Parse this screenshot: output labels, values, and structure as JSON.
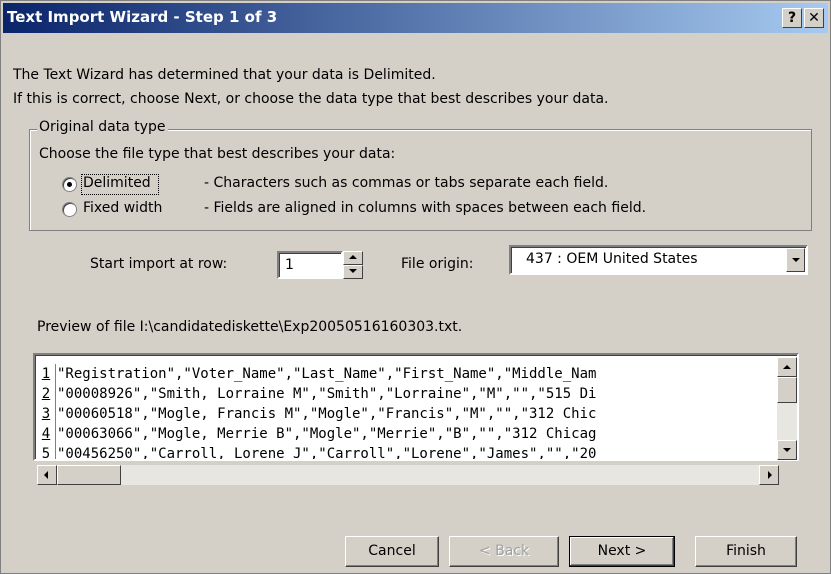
{
  "window": {
    "title": "Text Import Wizard - Step 1 of 3",
    "help_btn": "?",
    "close_btn": "✕"
  },
  "intro": {
    "line1": "The Text Wizard has determined that your data is Delimited.",
    "line2": "If this is correct, choose Next, or choose the data type that best describes your data."
  },
  "original_type": {
    "group_label": "Original data type",
    "prompt": "Choose the file type that best describes your data:",
    "options": [
      {
        "label": "Delimited",
        "desc": "- Characters such as commas or tabs separate each field.",
        "selected": true
      },
      {
        "label": "Fixed width",
        "desc": "- Fields are aligned in columns with spaces between each field.",
        "selected": false
      }
    ]
  },
  "start_row": {
    "label": "Start import at row:",
    "value": "1"
  },
  "file_origin": {
    "label": "File origin:",
    "value": "437 : OEM United States"
  },
  "preview": {
    "label": "Preview of file I:\\candidatediskette\\Exp20050516160303.txt.",
    "rows": [
      {
        "num": "1",
        "text": "\"Registration\",\"Voter_Name\",\"Last_Name\",\"First_Name\",\"Middle_Nam"
      },
      {
        "num": "2",
        "text": "\"00008926\",\"Smith, Lorraine M\",\"Smith\",\"Lorraine\",\"M\",\"\",\"515 Di"
      },
      {
        "num": "3",
        "text": "\"00060518\",\"Mogle, Francis M\",\"Mogle\",\"Francis\",\"M\",\"\",\"312 Chic"
      },
      {
        "num": "4",
        "text": "\"00063066\",\"Mogle, Merrie B\",\"Mogle\",\"Merrie\",\"B\",\"\",\"312 Chicag"
      },
      {
        "num": "5",
        "text": "\"00456250\",\"Carroll, Lorene J\",\"Carroll\",\"Lorene\",\"James\",\"\",\"20"
      }
    ]
  },
  "buttons": {
    "cancel": "Cancel",
    "back": "< Back",
    "next": "Next >",
    "finish": "Finish"
  }
}
